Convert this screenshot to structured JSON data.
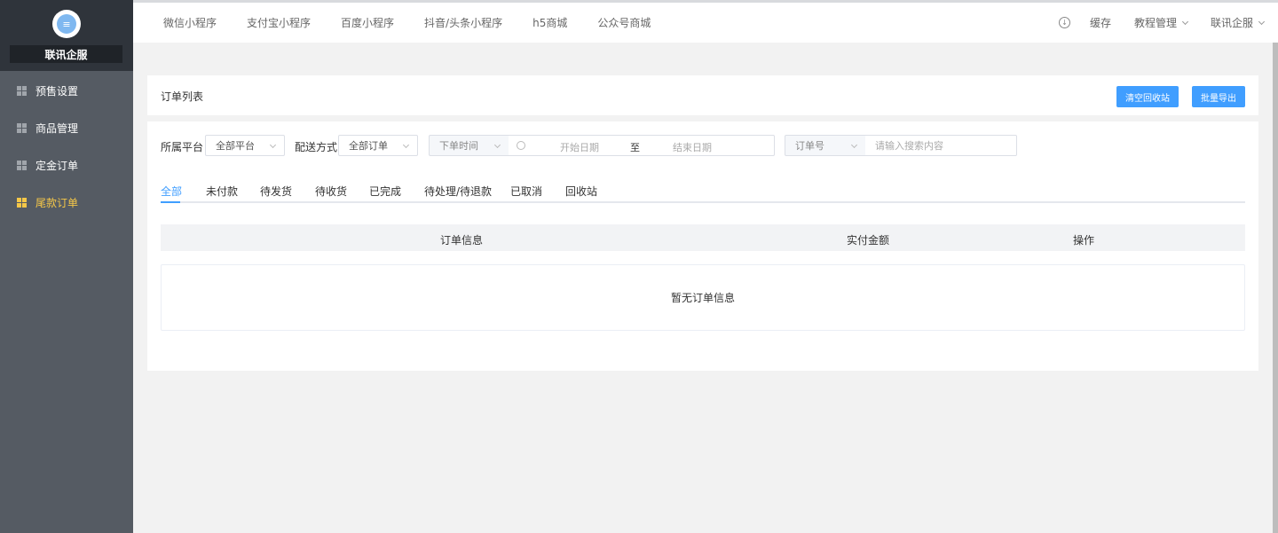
{
  "sidebar": {
    "brand": "联讯企服",
    "logo_glyph": "≡",
    "items": [
      {
        "label": "预售设置",
        "icon": "grid-icon"
      },
      {
        "label": "商品管理",
        "icon": "grid-icon"
      },
      {
        "label": "定金订单",
        "icon": "grid-icon"
      },
      {
        "label": "尾款订单",
        "icon": "grid-icon",
        "active": true
      }
    ]
  },
  "topnav": {
    "links": [
      "微信小程序",
      "支付宝小程序",
      "百度小程序",
      "抖音/头条小程序",
      "h5商城",
      "公众号商城"
    ],
    "download_glyph": "↓",
    "cache": "缓存",
    "tutorial": "教程管理",
    "account": "联讯企服"
  },
  "header": {
    "title": "订单列表",
    "clear_button": "清空回收站",
    "export_button": "批量导出"
  },
  "filters": {
    "platform_label": "所属平台",
    "platform_value": "全部平台",
    "delivery_label": "配送方式",
    "delivery_value": "全部订单",
    "time_type": "下单时间",
    "start_placeholder": "开始日期",
    "range_separator": "至",
    "end_placeholder": "结束日期",
    "search_type": "订单号",
    "search_placeholder": "请输入搜索内容"
  },
  "tabs": [
    "全部",
    "未付款",
    "待发货",
    "待收货",
    "已完成",
    "待处理/待退款",
    "已取消",
    "回收站"
  ],
  "table": {
    "columns": [
      "订单信息",
      "实付金额",
      "操作"
    ],
    "empty_text": "暂无订单信息"
  },
  "colors": {
    "primary": "#409eff",
    "sidebar_active": "#f5c748",
    "sidebar_bg": "#555b63"
  }
}
